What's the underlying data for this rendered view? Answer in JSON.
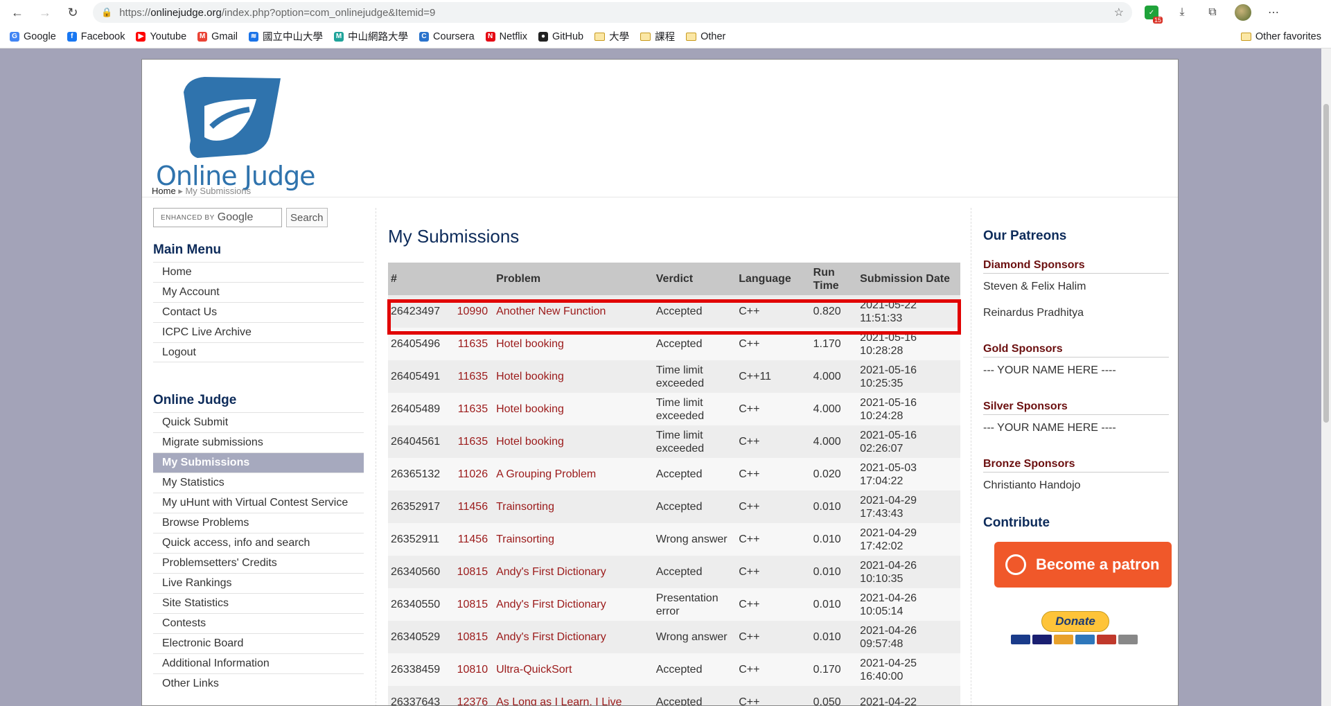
{
  "browser": {
    "url_host": "onlinejudge.org",
    "url_path": "/index.php?option=com_onlinejudge&Itemid=9",
    "url_scheme": "https://",
    "ext_badge": "15",
    "bookmarks": [
      {
        "label": "Google",
        "icon": "google-icon",
        "color": "#4285f4",
        "glyph": "G"
      },
      {
        "label": "Facebook",
        "icon": "facebook-icon",
        "color": "#1877f2",
        "glyph": "f"
      },
      {
        "label": "Youtube",
        "icon": "youtube-icon",
        "color": "#ff0000",
        "glyph": "▶"
      },
      {
        "label": "Gmail",
        "icon": "gmail-icon",
        "color": "#ea4335",
        "glyph": "M"
      },
      {
        "label": "國立中山大學",
        "icon": "nsysu-icon",
        "color": "#1a73e8",
        "glyph": "≋"
      },
      {
        "label": "中山網路大學",
        "icon": "cyber-univ-icon",
        "color": "#1fa39a",
        "glyph": "M"
      },
      {
        "label": "Coursera",
        "icon": "coursera-icon",
        "color": "#2a73cc",
        "glyph": "C"
      },
      {
        "label": "Netflix",
        "icon": "netflix-icon",
        "color": "#e50914",
        "glyph": "N"
      },
      {
        "label": "GitHub",
        "icon": "github-icon",
        "color": "#222222",
        "glyph": "●"
      },
      {
        "label": "大學",
        "icon": "folder-icon",
        "folder": true
      },
      {
        "label": "課程",
        "icon": "folder-icon",
        "folder": true
      },
      {
        "label": "Other",
        "icon": "folder-icon",
        "folder": true
      }
    ],
    "other_favorites": "Other favorites"
  },
  "site": {
    "logo_text": "Online Judge",
    "breadcrumb": {
      "home": "Home",
      "current": "My Submissions"
    },
    "search": {
      "brand_prefix": "ENHANCED BY",
      "brand": "Google",
      "button": "Search"
    }
  },
  "main_menu": {
    "title": "Main Menu",
    "items": [
      "Home",
      "My Account",
      "Contact Us",
      "ICPC Live Archive",
      "Logout"
    ]
  },
  "oj_menu": {
    "title": "Online Judge",
    "items": [
      "Quick Submit",
      "Migrate submissions",
      "My Submissions",
      "My Statistics",
      "My uHunt with Virtual Contest Service",
      "Browse Problems",
      "Quick access, info and search",
      "Problemsetters' Credits",
      "Live Rankings",
      "Site Statistics",
      "Contests",
      "Electronic Board",
      "Additional Information",
      "Other Links"
    ],
    "active": "My Submissions"
  },
  "submissions": {
    "title": "My Submissions",
    "columns": [
      "#",
      "",
      "Problem",
      "Verdict",
      "Language",
      "Run Time",
      "Submission Date"
    ],
    "rows": [
      {
        "id": "26423497",
        "pid": "10990",
        "name": "Another New Function",
        "verdict": "Accepted",
        "lang": "C++",
        "time": "0.820",
        "date": "2021-05-22 11:51:33"
      },
      {
        "id": "26405496",
        "pid": "11635",
        "name": "Hotel booking",
        "verdict": "Accepted",
        "lang": "C++",
        "time": "1.170",
        "date": "2021-05-16 10:28:28"
      },
      {
        "id": "26405491",
        "pid": "11635",
        "name": "Hotel booking",
        "verdict": "Time limit exceeded",
        "lang": "C++11",
        "time": "4.000",
        "date": "2021-05-16 10:25:35"
      },
      {
        "id": "26405489",
        "pid": "11635",
        "name": "Hotel booking",
        "verdict": "Time limit exceeded",
        "lang": "C++",
        "time": "4.000",
        "date": "2021-05-16 10:24:28"
      },
      {
        "id": "26404561",
        "pid": "11635",
        "name": "Hotel booking",
        "verdict": "Time limit exceeded",
        "lang": "C++",
        "time": "4.000",
        "date": "2021-05-16 02:26:07"
      },
      {
        "id": "26365132",
        "pid": "11026",
        "name": "A Grouping Problem",
        "verdict": "Accepted",
        "lang": "C++",
        "time": "0.020",
        "date": "2021-05-03 17:04:22"
      },
      {
        "id": "26352917",
        "pid": "11456",
        "name": "Trainsorting",
        "verdict": "Accepted",
        "lang": "C++",
        "time": "0.010",
        "date": "2021-04-29 17:43:43"
      },
      {
        "id": "26352911",
        "pid": "11456",
        "name": "Trainsorting",
        "verdict": "Wrong answer",
        "lang": "C++",
        "time": "0.010",
        "date": "2021-04-29 17:42:02"
      },
      {
        "id": "26340560",
        "pid": "10815",
        "name": "Andy's First Dictionary",
        "verdict": "Accepted",
        "lang": "C++",
        "time": "0.010",
        "date": "2021-04-26 10:10:35"
      },
      {
        "id": "26340550",
        "pid": "10815",
        "name": "Andy's First Dictionary",
        "verdict": "Presentation error",
        "lang": "C++",
        "time": "0.010",
        "date": "2021-04-26 10:05:14"
      },
      {
        "id": "26340529",
        "pid": "10815",
        "name": "Andy's First Dictionary",
        "verdict": "Wrong answer",
        "lang": "C++",
        "time": "0.010",
        "date": "2021-04-26 09:57:48"
      },
      {
        "id": "26338459",
        "pid": "10810",
        "name": "Ultra-QuickSort",
        "verdict": "Accepted",
        "lang": "C++",
        "time": "0.170",
        "date": "2021-04-25 16:40:00"
      },
      {
        "id": "26337643",
        "pid": "12376",
        "name": "As Long as I Learn, I Live",
        "verdict": "Accepted",
        "lang": "C++",
        "time": "0.050",
        "date": "2021-04-22"
      }
    ]
  },
  "sidebar_right": {
    "title": "Our Patreons",
    "groups": [
      {
        "title": "Diamond Sponsors",
        "names": [
          "Steven & Felix Halim",
          "Reinardus Pradhitya"
        ]
      },
      {
        "title": "Gold Sponsors",
        "names": [
          "--- YOUR NAME HERE ----"
        ]
      },
      {
        "title": "Silver Sponsors",
        "names": [
          "--- YOUR NAME HERE ----"
        ]
      },
      {
        "title": "Bronze Sponsors",
        "names": [
          "Christianto Handojo"
        ]
      }
    ],
    "contribute": "Contribute",
    "patron_button": "Become a patron",
    "donate_button": "Donate"
  },
  "colors": {
    "accent_dark_blue": "#0d2b5a",
    "problem_red": "#9b1a1a",
    "highlight_red": "#e10000",
    "patron_orange": "#f0582a"
  }
}
